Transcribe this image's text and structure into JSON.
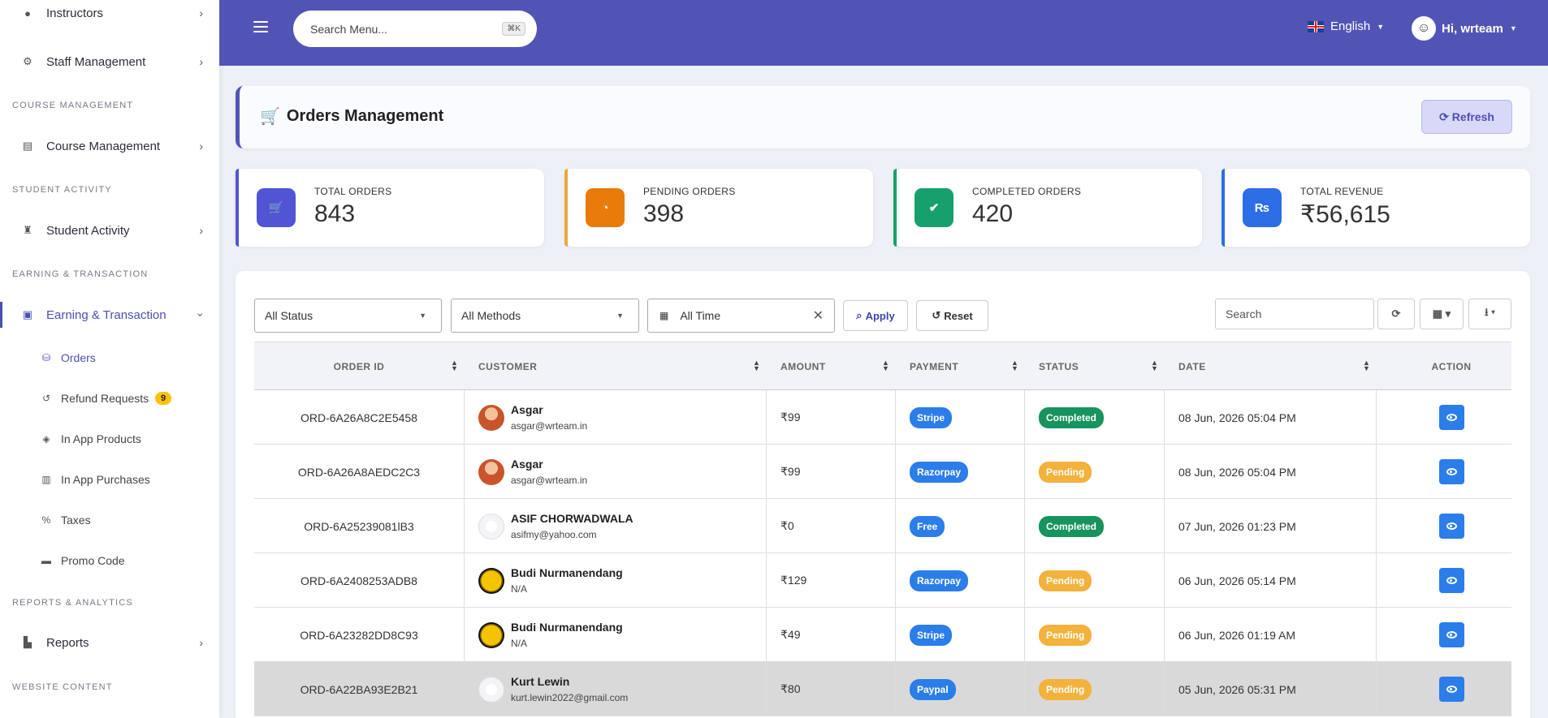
{
  "sidebar": {
    "items": [
      {
        "label": "Instructors"
      },
      {
        "label": "Staff Management"
      },
      {
        "label": "Course Management"
      },
      {
        "label": "Student Activity"
      },
      {
        "label": "Earning & Transaction"
      },
      {
        "label": "Reports"
      }
    ],
    "sections": [
      "COURSE MANAGEMENT",
      "STUDENT ACTIVITY",
      "EARNING & TRANSACTION",
      "REPORTS & ANALYTICS",
      "WEBSITE CONTENT"
    ],
    "subitems": [
      {
        "label": "Orders"
      },
      {
        "label": "Refund Requests",
        "badge": "9"
      },
      {
        "label": "In App Products"
      },
      {
        "label": "In App Purchases"
      },
      {
        "label": "Taxes"
      },
      {
        "label": "Promo Code"
      }
    ]
  },
  "header": {
    "search_placeholder": "Search Menu...",
    "shortcut": "⌘K",
    "language": "English",
    "user_greeting": "Hi, wrteam"
  },
  "page": {
    "title": "Orders Management",
    "refresh_label": "Refresh"
  },
  "stats": [
    {
      "label": "TOTAL ORDERS",
      "value": "843",
      "color": "#5254d6"
    },
    {
      "label": "PENDING ORDERS",
      "value": "398",
      "color": "#e97b0b"
    },
    {
      "label": "COMPLETED ORDERS",
      "value": "420",
      "color": "#17a06b"
    },
    {
      "label": "TOTAL REVENUE",
      "value": "₹56,615",
      "color": "#2d6de6"
    }
  ],
  "filters": {
    "status": "All Status",
    "methods": "All Methods",
    "time": "All Time",
    "apply": "Apply",
    "reset": "Reset",
    "search_placeholder": "Search"
  },
  "table": {
    "columns": [
      "ORDER ID",
      "CUSTOMER",
      "AMOUNT",
      "PAYMENT",
      "STATUS",
      "DATE",
      "ACTION"
    ],
    "rows": [
      {
        "id": "ORD-6A26A8C2E5458",
        "name": "Asgar",
        "email": "asgar@wrteam.in",
        "amount": "₹99",
        "payment": "Stripe",
        "status": "Completed",
        "date": "08 Jun, 2026 05:04 PM",
        "avatar": "photo"
      },
      {
        "id": "ORD-6A26A8AEDC2C3",
        "name": "Asgar",
        "email": "asgar@wrteam.in",
        "amount": "₹99",
        "payment": "Razorpay",
        "status": "Pending",
        "date": "08 Jun, 2026 05:04 PM",
        "avatar": "photo"
      },
      {
        "id": "ORD-6A25239081lB3",
        "name": "ASIF CHORWADWALA",
        "email": "asifmy@yahoo.com",
        "amount": "₹0",
        "payment": "Free",
        "status": "Completed",
        "date": "07 Jun, 2026 01:23 PM",
        "avatar": "placeholder"
      },
      {
        "id": "ORD-6A2408253ADB8",
        "name": "Budi Nurmanendang",
        "email": "N/A",
        "amount": "₹129",
        "payment": "Razorpay",
        "status": "Pending",
        "date": "06 Jun, 2026 05:14 PM",
        "avatar": "smiley"
      },
      {
        "id": "ORD-6A23282DD8C93",
        "name": "Budi Nurmanendang",
        "email": "N/A",
        "amount": "₹49",
        "payment": "Stripe",
        "status": "Pending",
        "date": "06 Jun, 2026 01:19 AM",
        "avatar": "smiley"
      },
      {
        "id": "ORD-6A22BA93E2B21",
        "name": "Kurt Lewin",
        "email": "kurt.lewin2022@gmail.com",
        "amount": "₹80",
        "payment": "Paypal",
        "status": "Pending",
        "date": "05 Jun, 2026 05:31 PM",
        "avatar": "placeholder"
      }
    ]
  },
  "colors": {
    "primary": "#5254b5",
    "completed": "#17935f",
    "pending": "#f3b23c",
    "payment": "#2b7de9"
  }
}
